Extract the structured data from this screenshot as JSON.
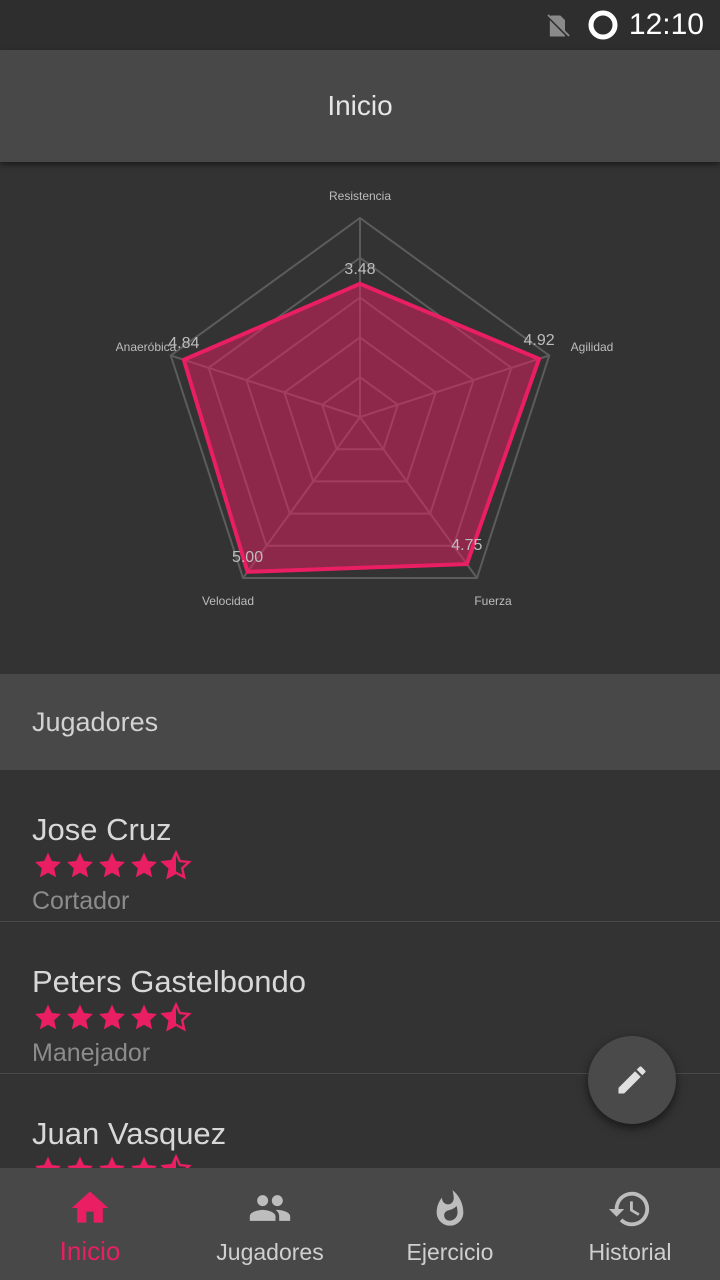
{
  "status_bar": {
    "time": "12:10"
  },
  "app_bar": {
    "title": "Inicio"
  },
  "chart_data": {
    "type": "radar",
    "axes": [
      "Resistencia",
      "Agilidad",
      "Fuerza",
      "Velocidad",
      "Anaeróbica"
    ],
    "values": [
      3.48,
      4.92,
      4.75,
      5.0,
      4.84
    ],
    "value_labels": [
      "3.48",
      "4.92",
      "4.75",
      "5.00",
      "4.84"
    ],
    "rmax": 5.2,
    "grid_levels": 5,
    "color": "#e91e63"
  },
  "section": {
    "title": "Jugadores"
  },
  "players": [
    {
      "name": "Jose Cruz",
      "role": "Cortador",
      "rating": 4.5
    },
    {
      "name": "Peters Gastelbondo",
      "role": "Manejador",
      "rating": 4.5
    },
    {
      "name": "Juan Vasquez",
      "role": "",
      "rating": 4.5
    }
  ],
  "bottom_nav": {
    "items": [
      {
        "label": "Inicio",
        "icon": "home-icon",
        "active": true
      },
      {
        "label": "Jugadores",
        "icon": "people-icon",
        "active": false
      },
      {
        "label": "Ejercicio",
        "icon": "flame-icon",
        "active": false
      },
      {
        "label": "Historial",
        "icon": "history-icon",
        "active": false
      }
    ]
  },
  "fab": {
    "icon": "pencil-icon"
  },
  "colors": {
    "accent": "#e91e63",
    "surface": "#484848",
    "background": "#333333"
  }
}
